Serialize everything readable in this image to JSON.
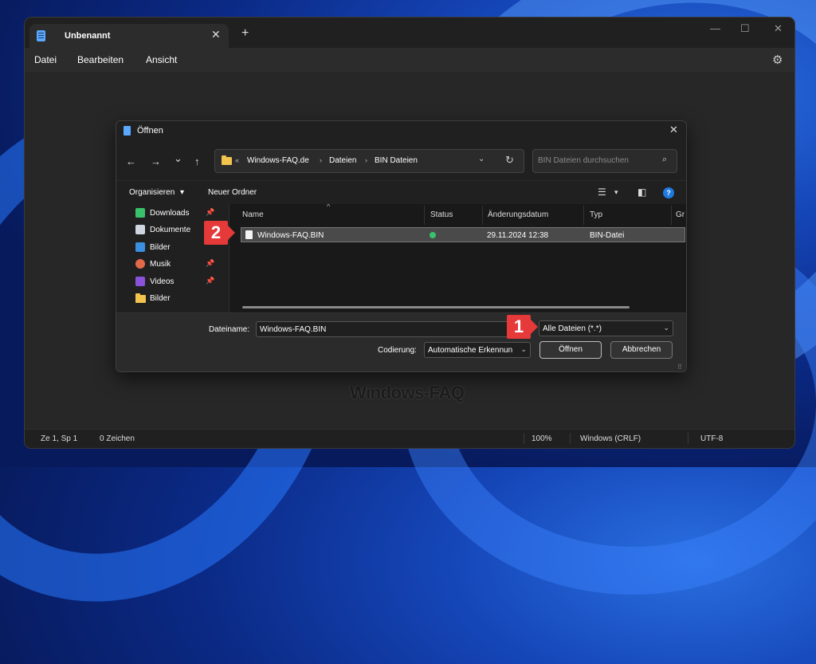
{
  "window": {
    "tab_title": "Unbenannt",
    "tab_close": "✕",
    "new_tab": "+",
    "minimize": "—",
    "maximize": "☐",
    "close": "✕"
  },
  "menu": {
    "file": "Datei",
    "edit": "Bearbeiten",
    "view": "Ansicht",
    "settings_icon": "⚙"
  },
  "watermark": "Windows-FAQ",
  "statusbar": {
    "position": "Ze 1, Sp 1",
    "chars": "0 Zeichen",
    "zoom": "100%",
    "line_endings": "Windows (CRLF)",
    "encoding": "UTF-8"
  },
  "dialog": {
    "title": "Öffnen",
    "close": "✕",
    "nav": {
      "back": "←",
      "forward": "→",
      "recent": "⌄",
      "up": "↑"
    },
    "address": {
      "prefix": "«",
      "crumbs": [
        "Windows-FAQ.de",
        "Dateien",
        "BIN Dateien"
      ],
      "sep": "›",
      "dropdown": "⌄",
      "refresh": "↻"
    },
    "search_placeholder": "BIN Dateien durchsuchen",
    "search_icon": "⌕",
    "toolbar": {
      "organize": "Organisieren",
      "organize_chev": "▾",
      "new_folder": "Neuer Ordner",
      "view_icon": "☰",
      "view_chev": "▾",
      "preview_icon": "◧",
      "help_icon": "?"
    },
    "nav_pane": [
      {
        "label": "Downloads",
        "icon": "download-icon",
        "color": "#3ac16b",
        "pinned": true
      },
      {
        "label": "Dokumente",
        "icon": "documents-icon",
        "color": "#cfd6e0",
        "pinned": true
      },
      {
        "label": "Bilder",
        "icon": "pictures-icon",
        "color": "#3a8fe0",
        "pinned": true
      },
      {
        "label": "Musik",
        "icon": "music-icon",
        "color": "#e26a4a",
        "pinned": true
      },
      {
        "label": "Videos",
        "icon": "videos-icon",
        "color": "#8a52d8",
        "pinned": true
      },
      {
        "label": "Bilder",
        "icon": "folder-icon",
        "color": "#f2c44d",
        "pinned": false
      }
    ],
    "pin_glyph": "📌",
    "columns": [
      "Name",
      "Status",
      "Änderungsdatum",
      "Typ",
      "Gr"
    ],
    "sort_indicator": "^",
    "files": [
      {
        "name": "Windows-FAQ.BIN",
        "status": "ok",
        "date": "29.11.2024 12:38",
        "type": "BIN-Datei"
      }
    ],
    "filename_label": "Dateiname:",
    "filename_value": "Windows-FAQ.BIN",
    "filetype_value": "Alle Dateien  (*.*)",
    "encoding_label": "Codierung:",
    "encoding_value": "Automatische Erkennun",
    "open_button": "Öffnen",
    "cancel_button": "Abbrechen",
    "chevron": "⌄"
  },
  "annotations": {
    "badge1": "1",
    "badge2": "2"
  }
}
